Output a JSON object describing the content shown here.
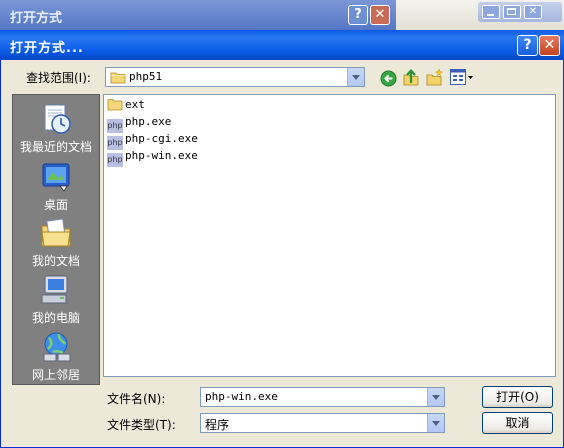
{
  "background_window": {
    "title": "打开方式"
  },
  "dialog": {
    "title": "打开方式...",
    "help_glyph": "?",
    "close_glyph": "✕"
  },
  "look_in": {
    "label": "查找范围(I):",
    "value": "php51"
  },
  "toolbar": {
    "icons": [
      "back-icon",
      "up-folder-icon",
      "new-folder-icon",
      "view-menu-icon"
    ]
  },
  "places": [
    {
      "label": "我最近的文档",
      "icon": "recent-documents-icon"
    },
    {
      "label": "桌面",
      "icon": "desktop-icon"
    },
    {
      "label": "我的文档",
      "icon": "my-documents-icon"
    },
    {
      "label": "我的电脑",
      "icon": "my-computer-icon"
    },
    {
      "label": "网上邻居",
      "icon": "network-places-icon"
    }
  ],
  "files": [
    {
      "name": "ext",
      "type": "folder"
    },
    {
      "name": "php.exe",
      "type": "exe"
    },
    {
      "name": "php-cgi.exe",
      "type": "exe"
    },
    {
      "name": "php-win.exe",
      "type": "exe"
    }
  ],
  "php_icon_text": "php",
  "filename": {
    "label": "文件名(N):",
    "value": "php-win.exe"
  },
  "filetype": {
    "label": "文件类型(T):",
    "value": "程序"
  },
  "buttons": {
    "open": "打开(O)",
    "cancel": "取消"
  },
  "colors": {
    "title_bar": "#0a5ae6",
    "places_bar": "#808080",
    "dialog_bg": "#ece9d8"
  }
}
